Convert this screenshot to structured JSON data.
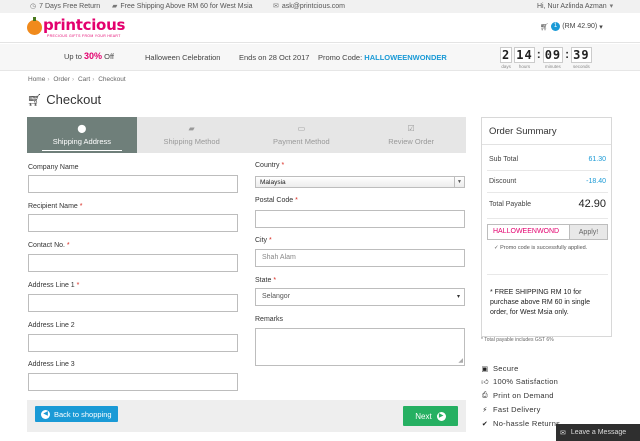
{
  "topbar": {
    "return_text": "7 Days Free Return",
    "shipping_text": "Free Shipping Above RM 60 for West Msia",
    "email": "ask@printcious.com",
    "greeting": "Hi, Nur Azlinda Azman"
  },
  "header": {
    "logo_text": "printcious",
    "logo_tagline": "PRECIOUS GIFTS FROM YOUR HEART",
    "cart_count": "1",
    "cart_total": "(RM 42.90)"
  },
  "promo": {
    "upto_prefix": "Up to",
    "discount": "30%",
    "upto_suffix": "Off",
    "campaign": "Halloween Celebration",
    "ends": "Ends on 28 Oct 2017",
    "code_label": "Promo Code:",
    "code": "HALLOWEENWONDER",
    "countdown": {
      "days": "2",
      "hours": "14",
      "minutes": "09",
      "seconds": "39",
      "days_label": "days",
      "hours_label": "hours",
      "minutes_label": "minutes",
      "seconds_label": "seconds"
    }
  },
  "breadcrumb": [
    "Home",
    "Order",
    "Cart",
    "Checkout"
  ],
  "page_title": "Checkout",
  "steps": [
    {
      "label": "Shipping Address",
      "icon": "map-marker-icon"
    },
    {
      "label": "Shipping Method",
      "icon": "truck-icon"
    },
    {
      "label": "Payment Method",
      "icon": "credit-card-icon"
    },
    {
      "label": "Review Order",
      "icon": "check-square-icon"
    }
  ],
  "form": {
    "company_label": "Company Name",
    "recipient_label": "Recipient Name",
    "contact_label": "Contact No.",
    "address1_label": "Address Line 1",
    "address2_label": "Address Line 2",
    "address3_label": "Address Line 3",
    "country_label": "Country",
    "country_value": "Malaysia",
    "postal_label": "Postal Code",
    "city_label": "City",
    "city_placeholder": "Shah Alam",
    "state_label": "State",
    "state_value": "Selangor",
    "remarks_label": "Remarks",
    "required_mark": "*"
  },
  "actions": {
    "back_label": "Back to shopping",
    "next_label": "Next"
  },
  "summary": {
    "title": "Order Summary",
    "subtotal_label": "Sub Total",
    "subtotal_value": "61.30",
    "discount_label": "Discount",
    "discount_value": "-18.40",
    "total_label": "Total Payable",
    "total_value": "42.90",
    "coupon_value": "HALLOWEENWOND",
    "apply_label": "Apply!",
    "coupon_success": "Promo code is successfully applied.",
    "shipping_note": "* FREE SHIPPING RM 10 for purchase above RM 60 in single order, for West Msia only.",
    "gst_note": "* Total payable includes GST 6%"
  },
  "badges": [
    {
      "label": "Secure",
      "icon": "lock-icon"
    },
    {
      "label": "100% Satisfaction",
      "icon": "thumbs-up-icon"
    },
    {
      "label": "Print on Demand",
      "icon": "print-icon"
    },
    {
      "label": "Fast Delivery",
      "icon": "bolt-icon"
    },
    {
      "label": "No-hassle Returns",
      "icon": "check-circle-icon"
    }
  ],
  "chat": {
    "label": "Leave a Message"
  },
  "colors": {
    "brand_pink": "#e3006e",
    "accent_blue": "#1a9ad6",
    "next_green": "#26b062",
    "active_step": "#6f7f7a"
  }
}
